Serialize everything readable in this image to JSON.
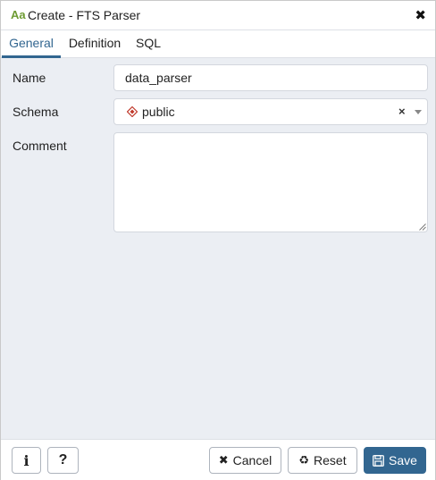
{
  "dialog": {
    "title_icon_text": "Aa",
    "title": "Create - FTS Parser",
    "close_glyph": "✖"
  },
  "tabs": [
    {
      "label": "General",
      "active": true
    },
    {
      "label": "Definition",
      "active": false
    },
    {
      "label": "SQL",
      "active": false
    }
  ],
  "form": {
    "name_label": "Name",
    "name_value": "data_parser",
    "schema_label": "Schema",
    "schema_value": "public",
    "schema_icon": "schema-icon",
    "clear_glyph": "×",
    "comment_label": "Comment",
    "comment_value": ""
  },
  "footer": {
    "info_label": "i",
    "help_label": "?",
    "cancel_icon": "✖",
    "cancel_label": "Cancel",
    "reset_icon": "♻",
    "reset_label": "Reset",
    "save_label": "Save"
  },
  "colors": {
    "accent": "#326690",
    "title_icon": "#6e9b33",
    "schema_icon": "#c0392b",
    "background": "#ebeef3"
  }
}
